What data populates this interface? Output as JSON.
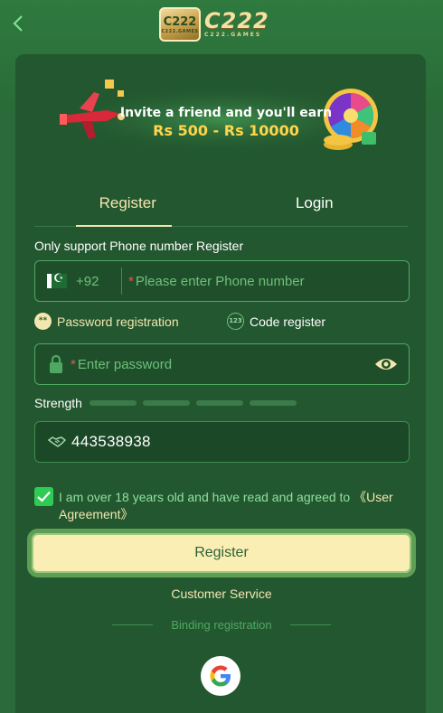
{
  "nav": {
    "back_icon": "chevron-left-icon"
  },
  "logo": {
    "badge_text": "C222",
    "badge_sub": "C222.GAMES",
    "wordmark": "C222",
    "wordmark_sub": "C222.GAMES"
  },
  "banner": {
    "line1": "Invite a friend and you'll earn",
    "line2": "Rs 500 - Rs 10000"
  },
  "tabs": [
    {
      "label": "Register",
      "active": true
    },
    {
      "label": "Login",
      "active": false
    }
  ],
  "form": {
    "support_label": "Only support Phone number Register",
    "phone": {
      "dial_code": "+92",
      "placeholder": "Please enter Phone number",
      "required_mark": "*"
    },
    "modes": {
      "password": "Password registration",
      "code": "Code register",
      "password_dot": "**",
      "code_dot": "123"
    },
    "password": {
      "placeholder": "Enter password",
      "required_mark": "*"
    },
    "strength_label": "Strength",
    "invite_code": "443538938",
    "agreement": {
      "text": "I am over 18 years old and have read and agreed to",
      "link": "《User Agreement》",
      "checked": true
    },
    "register_button": "Register"
  },
  "footer": {
    "customer_service": "Customer Service",
    "binding": "Binding registration"
  },
  "colors": {
    "accent": "#f3e7b0",
    "field_border": "#4fa862",
    "check": "#2ecc52",
    "background": "#23572f"
  }
}
